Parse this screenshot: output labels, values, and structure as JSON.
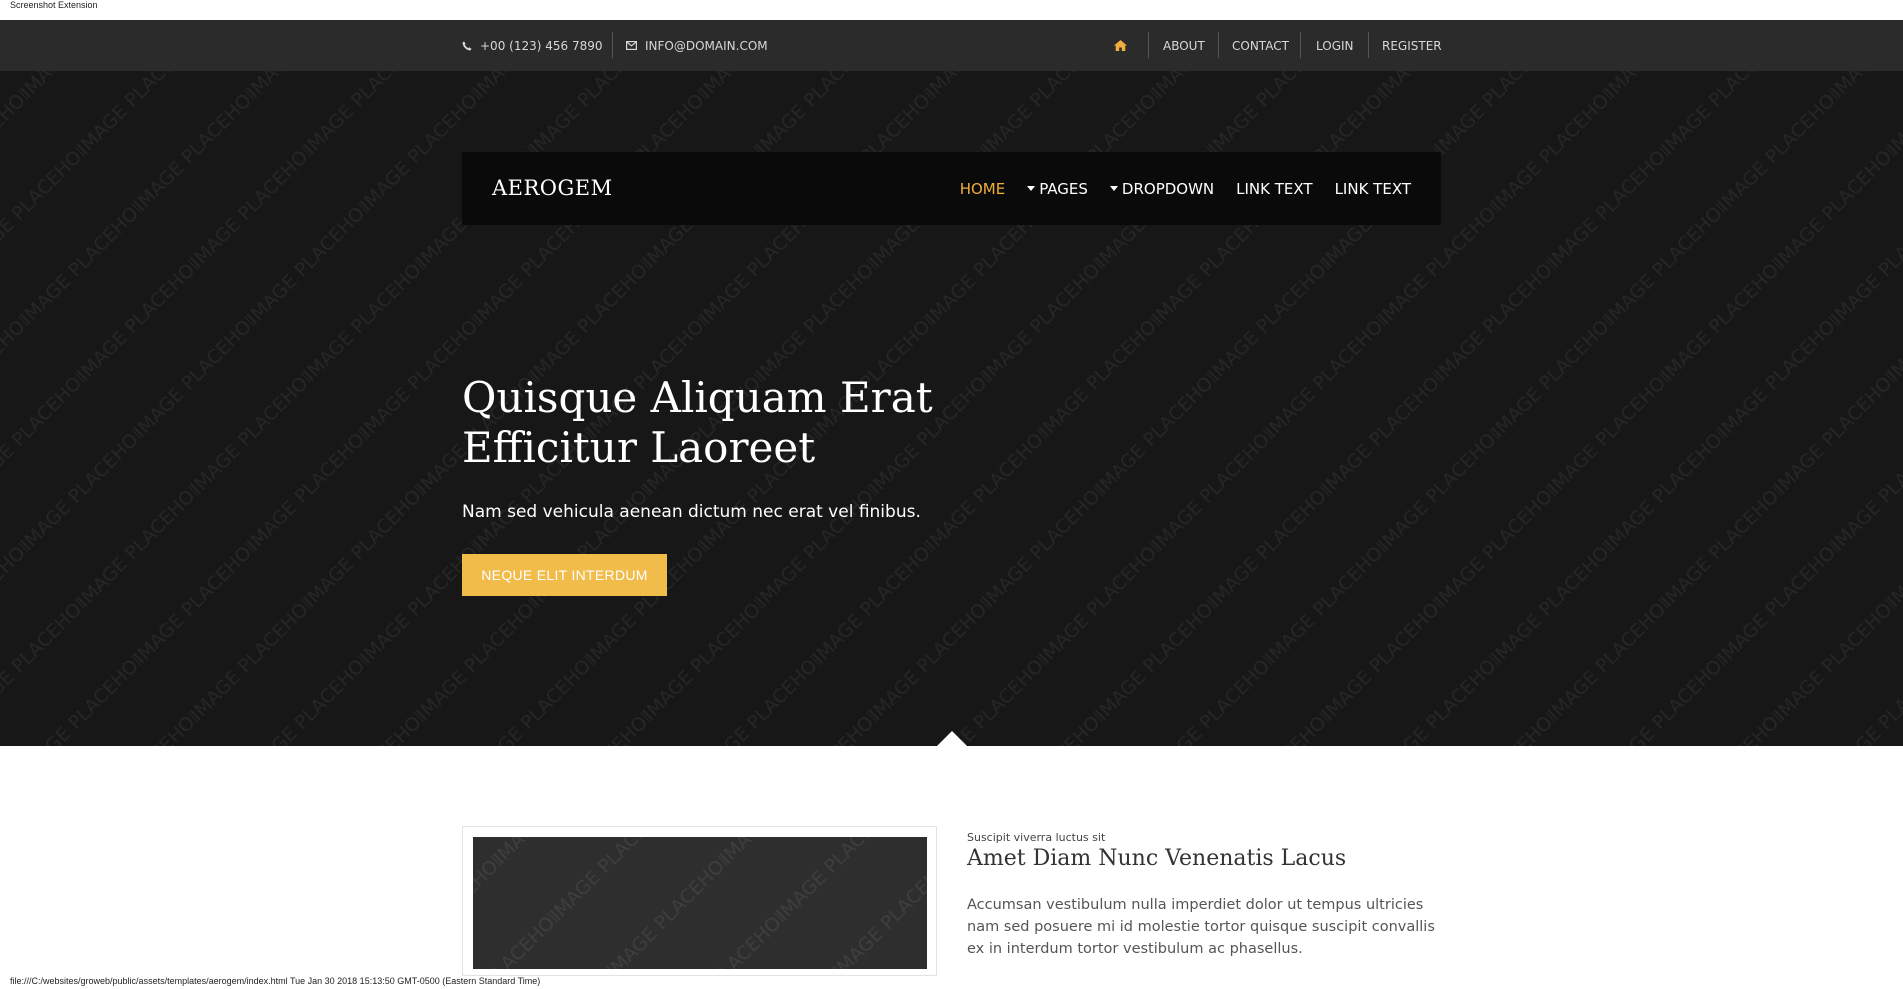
{
  "extension_label": "Screenshot Extension",
  "topbar": {
    "phone": "+00 (123) 456 7890",
    "email": "INFO@DOMAIN.COM",
    "nav": [
      "ABOUT",
      "CONTACT",
      "LOGIN",
      "REGISTER"
    ]
  },
  "hero": {
    "watermark": "IMAGE PLACEHOLDER",
    "brand": "AEROGEM",
    "menu": [
      "HOME",
      "PAGES",
      "DROPDOWN",
      "LINK TEXT",
      "LINK TEXT"
    ],
    "title_line1": "Quisque Aliquam Erat",
    "title_line2": "Efficitur Laoreet",
    "subtitle": "Nam sed vehicula aenean dictum nec erat vel finibus.",
    "button": "NEQUE ELIT INTERDUM"
  },
  "content": {
    "kicker": "Suscipit viverra luctus sit",
    "title": "Amet Diam Nunc Venenatis Lacus",
    "body": "Accumsan vestibulum nulla imperdiet dolor ut tempus ultricies nam sed posuere mi id molestie tortor quisque suscipit convallis ex in interdum tortor vestibulum ac phasellus."
  },
  "status_bar": "file:///C:/websites/groweb/public/assets/templates/aerogem/index.html Tue Jan 30 2018 15:13:50 GMT-0500 (Eastern Standard Time)",
  "colors": {
    "accent": "#f0ad3e",
    "button": "#f2bc4b",
    "topbar": "#2b2b2b",
    "hero": "#171717",
    "navbar": "#0a0a0a"
  }
}
